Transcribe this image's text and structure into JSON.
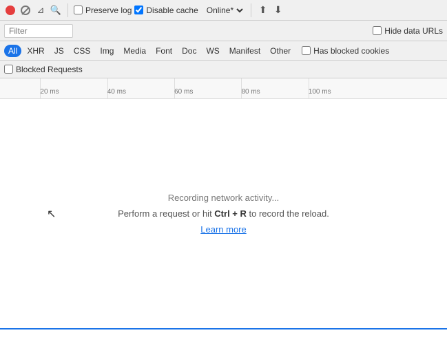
{
  "toolbar": {
    "preserve_log_label": "Preserve log",
    "disable_cache_label": "Disable cache",
    "online_label": "Online*",
    "preserve_log_checked": false,
    "disable_cache_checked": true
  },
  "filter_bar": {
    "filter_placeholder": "Filter",
    "hide_urls_label": "Hide data URLs",
    "hide_urls_checked": false
  },
  "filter_tabs": {
    "tabs": [
      {
        "id": "all",
        "label": "All",
        "active": true
      },
      {
        "id": "xhr",
        "label": "XHR",
        "active": false
      },
      {
        "id": "js",
        "label": "JS",
        "active": false
      },
      {
        "id": "css",
        "label": "CSS",
        "active": false
      },
      {
        "id": "img",
        "label": "Img",
        "active": false
      },
      {
        "id": "media",
        "label": "Media",
        "active": false
      },
      {
        "id": "font",
        "label": "Font",
        "active": false
      },
      {
        "id": "doc",
        "label": "Doc",
        "active": false
      },
      {
        "id": "ws",
        "label": "WS",
        "active": false
      },
      {
        "id": "manifest",
        "label": "Manifest",
        "active": false
      },
      {
        "id": "other",
        "label": "Other",
        "active": false
      }
    ],
    "has_blocked_cookies_label": "Has blocked cookies",
    "blocked_requests_label": "Blocked Requests"
  },
  "timeline": {
    "ticks": [
      {
        "label": "20 ms",
        "left_pct": 9
      },
      {
        "label": "40 ms",
        "left_pct": 24
      },
      {
        "label": "60 ms",
        "left_pct": 39
      },
      {
        "label": "80 ms",
        "left_pct": 54
      },
      {
        "label": "100 ms",
        "left_pct": 69
      }
    ]
  },
  "main": {
    "recording_text": "Recording network activity...",
    "perform_text_before": "Perform a request or hit ",
    "ctrl_r_text": "Ctrl + R",
    "perform_text_after": " to record the reload.",
    "learn_more_text": "Learn more"
  },
  "icons": {
    "stop": "⏺",
    "ban": "🚫",
    "filter": "▼",
    "search": "🔍",
    "upload": "⬆",
    "download": "⬇",
    "cursor": "↖"
  }
}
